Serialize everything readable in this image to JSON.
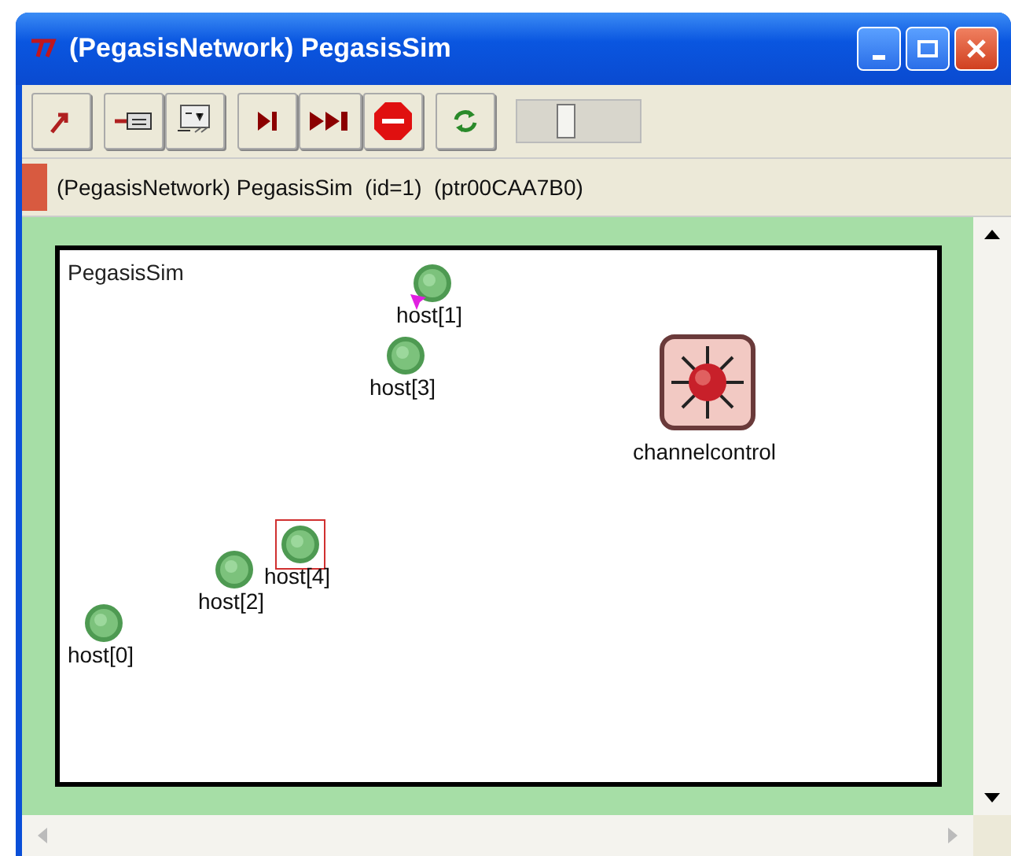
{
  "window": {
    "title": "(PegasisNetwork) PegasisSim"
  },
  "toolbar": {
    "slider": {
      "level": 0.38
    }
  },
  "info_bar": {
    "text": "(PegasisNetwork) PegasisSim  (id=1)  (ptr00CAA7B0)"
  },
  "canvas": {
    "title": "PegasisSim",
    "nodes": [
      {
        "kind": "host",
        "label": "host[1]",
        "selected": false
      },
      {
        "kind": "host",
        "label": "host[3]",
        "selected": false
      },
      {
        "kind": "control",
        "label": "channelcontrol",
        "selected": false
      },
      {
        "kind": "host",
        "label": "host[4]",
        "selected": true
      },
      {
        "kind": "host",
        "label": "host[2]",
        "selected": false
      },
      {
        "kind": "host",
        "label": "host[0]",
        "selected": false
      }
    ]
  }
}
